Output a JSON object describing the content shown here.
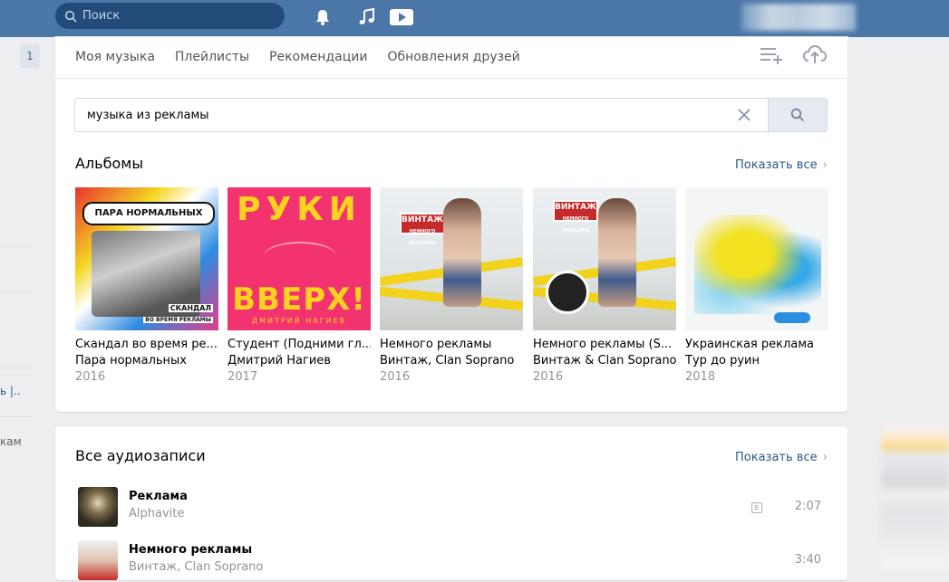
{
  "topbar": {
    "search_placeholder": "Поиск",
    "icons": [
      "bell-icon",
      "music-note-icon",
      "video-play-icon"
    ]
  },
  "left": {
    "badge": "1",
    "frag1": "ь |..",
    "frag2": "кам"
  },
  "tabs": [
    "Моя музыка",
    "Плейлисты",
    "Рекомендации",
    "Обновления друзей"
  ],
  "header_icons": [
    "playlist-add-icon",
    "cloud-upload-icon"
  ],
  "search": {
    "value": "музыка из рекламы"
  },
  "albums_section": {
    "title": "Альбомы",
    "show_all": "Показать все",
    "items": [
      {
        "title": "Скандал во время ре...",
        "artist": "Пара нормальных",
        "year": "2016",
        "cover_text": [
          "ПАРА НОРМАЛЬНЫХ",
          "СКАНДАЛ",
          "ВО ВРЕМЯ РЕКЛАМЫ"
        ]
      },
      {
        "title": "Студент (Подними гл...",
        "artist": "Дмитрий Нагиев",
        "year": "2017",
        "cover_text": [
          "РУКИ",
          "ВВЕРХ!",
          "ДМИТРИЙ НАГИЕВ"
        ]
      },
      {
        "title": "Немного рекламы",
        "artist": "Винтаж, Clan Soprano",
        "year": "2016",
        "cover_text": [
          "ВИНТАЖ",
          "НЕМНОГО РЕКЛАМЫ"
        ]
      },
      {
        "title": "Немного рекламы (S...",
        "artist": "Винтаж & Clan Soprano",
        "year": "2016",
        "cover_text": [
          "ВИНТАЖ",
          "НЕМНОГО РЕКЛАМЫ"
        ]
      },
      {
        "title": "Украинская реклама",
        "artist": "Тур до руин",
        "year": "2018",
        "cover_text": []
      }
    ]
  },
  "audio_section": {
    "title": "Все аудиозаписи",
    "show_all": "Показать все",
    "tracks": [
      {
        "name": "Реклама",
        "artist": "Alphavite",
        "duration": "2:07",
        "explicit": "E"
      },
      {
        "name": "Немного рекламы",
        "artist": "Винтаж, Clan Soprano",
        "duration": "3:40"
      }
    ]
  },
  "colors": {
    "header": "#4a76a8",
    "link": "#2a5885",
    "muted": "#939393",
    "background": "#edeef0"
  }
}
